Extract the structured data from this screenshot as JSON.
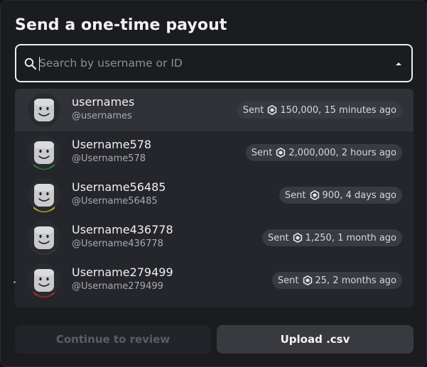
{
  "dialog": {
    "title": "Send a one-time payout"
  },
  "search": {
    "placeholder": "Search by username or ID",
    "value": ""
  },
  "results": [
    {
      "name": "usernames",
      "handle": "@usernames",
      "sent_label": "Sent",
      "amount_info": "150,000, 15 minutes ago",
      "accent": "#2a2b30",
      "hover": true
    },
    {
      "name": "Username578",
      "handle": "@Username578",
      "sent_label": "Sent",
      "amount_info": "2,000,000, 2 hours ago",
      "accent": "#2f8a3a",
      "hover": false
    },
    {
      "name": "Username56485",
      "handle": "@Username56485",
      "sent_label": "Sent",
      "amount_info": "900, 4 days ago",
      "accent": "#e0c21a",
      "hover": false
    },
    {
      "name": "Username436778",
      "handle": "@Username436778",
      "sent_label": "Sent",
      "amount_info": "1,250, 1 month ago",
      "accent": "#3a3b41",
      "hover": false
    },
    {
      "name": "Username279499",
      "handle": "@Username279499",
      "sent_label": "Sent",
      "amount_info": "25, 2 months ago",
      "accent": "#c62828",
      "hover": false
    }
  ],
  "actions": {
    "continue_label": "Continue to review",
    "upload_label": "Upload .csv"
  },
  "icons": {
    "search": "search-icon",
    "dropdown": "chevron-up-icon",
    "currency": "robux-icon",
    "avatar": "avatar-face-icon"
  }
}
